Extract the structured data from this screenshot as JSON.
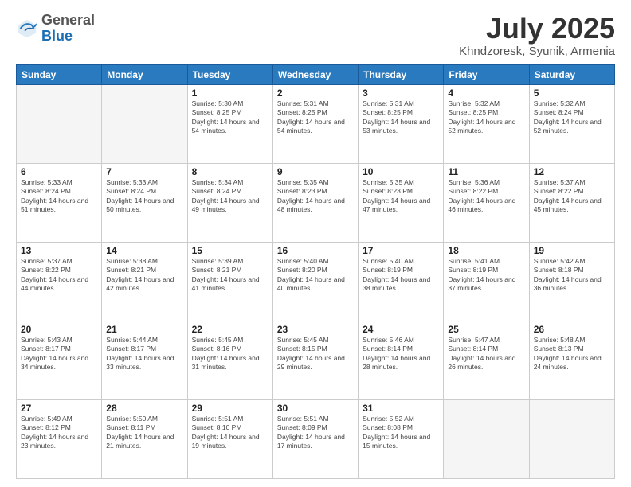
{
  "logo": {
    "general": "General",
    "blue": "Blue"
  },
  "header": {
    "month": "July 2025",
    "location": "Khndzoresk, Syunik, Armenia"
  },
  "weekdays": [
    "Sunday",
    "Monday",
    "Tuesday",
    "Wednesday",
    "Thursday",
    "Friday",
    "Saturday"
  ],
  "weeks": [
    [
      {
        "day": "",
        "sunrise": "",
        "sunset": "",
        "daylight": ""
      },
      {
        "day": "",
        "sunrise": "",
        "sunset": "",
        "daylight": ""
      },
      {
        "day": "1",
        "sunrise": "Sunrise: 5:30 AM",
        "sunset": "Sunset: 8:25 PM",
        "daylight": "Daylight: 14 hours and 54 minutes."
      },
      {
        "day": "2",
        "sunrise": "Sunrise: 5:31 AM",
        "sunset": "Sunset: 8:25 PM",
        "daylight": "Daylight: 14 hours and 54 minutes."
      },
      {
        "day": "3",
        "sunrise": "Sunrise: 5:31 AM",
        "sunset": "Sunset: 8:25 PM",
        "daylight": "Daylight: 14 hours and 53 minutes."
      },
      {
        "day": "4",
        "sunrise": "Sunrise: 5:32 AM",
        "sunset": "Sunset: 8:25 PM",
        "daylight": "Daylight: 14 hours and 52 minutes."
      },
      {
        "day": "5",
        "sunrise": "Sunrise: 5:32 AM",
        "sunset": "Sunset: 8:24 PM",
        "daylight": "Daylight: 14 hours and 52 minutes."
      }
    ],
    [
      {
        "day": "6",
        "sunrise": "Sunrise: 5:33 AM",
        "sunset": "Sunset: 8:24 PM",
        "daylight": "Daylight: 14 hours and 51 minutes."
      },
      {
        "day": "7",
        "sunrise": "Sunrise: 5:33 AM",
        "sunset": "Sunset: 8:24 PM",
        "daylight": "Daylight: 14 hours and 50 minutes."
      },
      {
        "day": "8",
        "sunrise": "Sunrise: 5:34 AM",
        "sunset": "Sunset: 8:24 PM",
        "daylight": "Daylight: 14 hours and 49 minutes."
      },
      {
        "day": "9",
        "sunrise": "Sunrise: 5:35 AM",
        "sunset": "Sunset: 8:23 PM",
        "daylight": "Daylight: 14 hours and 48 minutes."
      },
      {
        "day": "10",
        "sunrise": "Sunrise: 5:35 AM",
        "sunset": "Sunset: 8:23 PM",
        "daylight": "Daylight: 14 hours and 47 minutes."
      },
      {
        "day": "11",
        "sunrise": "Sunrise: 5:36 AM",
        "sunset": "Sunset: 8:22 PM",
        "daylight": "Daylight: 14 hours and 46 minutes."
      },
      {
        "day": "12",
        "sunrise": "Sunrise: 5:37 AM",
        "sunset": "Sunset: 8:22 PM",
        "daylight": "Daylight: 14 hours and 45 minutes."
      }
    ],
    [
      {
        "day": "13",
        "sunrise": "Sunrise: 5:37 AM",
        "sunset": "Sunset: 8:22 PM",
        "daylight": "Daylight: 14 hours and 44 minutes."
      },
      {
        "day": "14",
        "sunrise": "Sunrise: 5:38 AM",
        "sunset": "Sunset: 8:21 PM",
        "daylight": "Daylight: 14 hours and 42 minutes."
      },
      {
        "day": "15",
        "sunrise": "Sunrise: 5:39 AM",
        "sunset": "Sunset: 8:21 PM",
        "daylight": "Daylight: 14 hours and 41 minutes."
      },
      {
        "day": "16",
        "sunrise": "Sunrise: 5:40 AM",
        "sunset": "Sunset: 8:20 PM",
        "daylight": "Daylight: 14 hours and 40 minutes."
      },
      {
        "day": "17",
        "sunrise": "Sunrise: 5:40 AM",
        "sunset": "Sunset: 8:19 PM",
        "daylight": "Daylight: 14 hours and 38 minutes."
      },
      {
        "day": "18",
        "sunrise": "Sunrise: 5:41 AM",
        "sunset": "Sunset: 8:19 PM",
        "daylight": "Daylight: 14 hours and 37 minutes."
      },
      {
        "day": "19",
        "sunrise": "Sunrise: 5:42 AM",
        "sunset": "Sunset: 8:18 PM",
        "daylight": "Daylight: 14 hours and 36 minutes."
      }
    ],
    [
      {
        "day": "20",
        "sunrise": "Sunrise: 5:43 AM",
        "sunset": "Sunset: 8:17 PM",
        "daylight": "Daylight: 14 hours and 34 minutes."
      },
      {
        "day": "21",
        "sunrise": "Sunrise: 5:44 AM",
        "sunset": "Sunset: 8:17 PM",
        "daylight": "Daylight: 14 hours and 33 minutes."
      },
      {
        "day": "22",
        "sunrise": "Sunrise: 5:45 AM",
        "sunset": "Sunset: 8:16 PM",
        "daylight": "Daylight: 14 hours and 31 minutes."
      },
      {
        "day": "23",
        "sunrise": "Sunrise: 5:45 AM",
        "sunset": "Sunset: 8:15 PM",
        "daylight": "Daylight: 14 hours and 29 minutes."
      },
      {
        "day": "24",
        "sunrise": "Sunrise: 5:46 AM",
        "sunset": "Sunset: 8:14 PM",
        "daylight": "Daylight: 14 hours and 28 minutes."
      },
      {
        "day": "25",
        "sunrise": "Sunrise: 5:47 AM",
        "sunset": "Sunset: 8:14 PM",
        "daylight": "Daylight: 14 hours and 26 minutes."
      },
      {
        "day": "26",
        "sunrise": "Sunrise: 5:48 AM",
        "sunset": "Sunset: 8:13 PM",
        "daylight": "Daylight: 14 hours and 24 minutes."
      }
    ],
    [
      {
        "day": "27",
        "sunrise": "Sunrise: 5:49 AM",
        "sunset": "Sunset: 8:12 PM",
        "daylight": "Daylight: 14 hours and 23 minutes."
      },
      {
        "day": "28",
        "sunrise": "Sunrise: 5:50 AM",
        "sunset": "Sunset: 8:11 PM",
        "daylight": "Daylight: 14 hours and 21 minutes."
      },
      {
        "day": "29",
        "sunrise": "Sunrise: 5:51 AM",
        "sunset": "Sunset: 8:10 PM",
        "daylight": "Daylight: 14 hours and 19 minutes."
      },
      {
        "day": "30",
        "sunrise": "Sunrise: 5:51 AM",
        "sunset": "Sunset: 8:09 PM",
        "daylight": "Daylight: 14 hours and 17 minutes."
      },
      {
        "day": "31",
        "sunrise": "Sunrise: 5:52 AM",
        "sunset": "Sunset: 8:08 PM",
        "daylight": "Daylight: 14 hours and 15 minutes."
      },
      {
        "day": "",
        "sunrise": "",
        "sunset": "",
        "daylight": ""
      },
      {
        "day": "",
        "sunrise": "",
        "sunset": "",
        "daylight": ""
      }
    ]
  ]
}
